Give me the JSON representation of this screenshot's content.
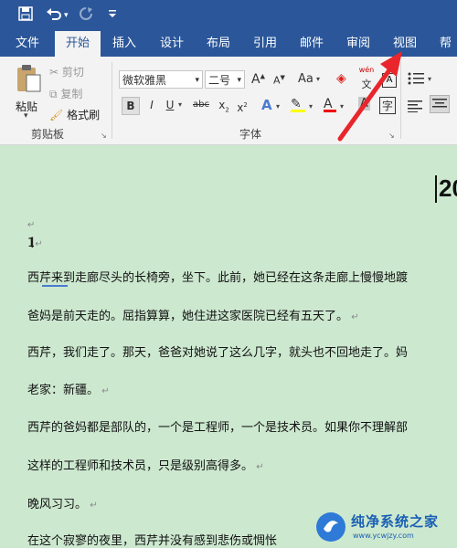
{
  "qat": {
    "save_icon": "save-icon",
    "undo_icon": "undo-icon",
    "redo_icon": "redo-icon",
    "customize_icon": "customize-icon"
  },
  "tabs": [
    {
      "label": "文件"
    },
    {
      "label": "开始"
    },
    {
      "label": "插入"
    },
    {
      "label": "设计"
    },
    {
      "label": "布局"
    },
    {
      "label": "引用"
    },
    {
      "label": "邮件"
    },
    {
      "label": "审阅"
    },
    {
      "label": "视图"
    },
    {
      "label": "帮助"
    }
  ],
  "clipboard": {
    "paste": "粘贴",
    "cut": "剪切",
    "copy": "复制",
    "format_painter": "格式刷",
    "group_label": "剪贴板"
  },
  "font": {
    "name": "微软雅黑",
    "size": "二号",
    "aa": "Aa",
    "group_label": "字体",
    "phonetic": "wén",
    "char_a": "A"
  },
  "document": {
    "title_fragment": "20",
    "list_number": "1",
    "paragraphs": [
      "西芹来到走廊尽头的长椅旁，坐下。此前，她已经在这条走廊上慢慢地踱",
      "爸妈是前天走的。屈指算算，她住进这家医院已经有五天了。",
      "西芹，我们走了。那天，爸爸对她说了这么几字，就头也不回地走了。妈",
      "老家：新疆。",
      "西芹的爸妈都是部队的，一个是工程师，一个是技术员。如果你不理解部",
      "这样的工程师和技术员，只是级别高得多。",
      "晚风习习。",
      "在这个寂寥的夜里，西芹并没有感到悲伤或惆怅"
    ]
  },
  "watermark": {
    "text": "纯净系统之家",
    "url": "www.ycwjzy.com"
  },
  "colors": {
    "brand": "#2b579a",
    "doc_bg": "#cce8cf",
    "arrow": "#e8262b"
  }
}
